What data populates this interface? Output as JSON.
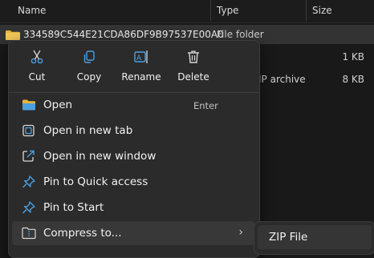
{
  "columns": {
    "name": "Name",
    "type": "Type",
    "size": "Size"
  },
  "rows": [
    {
      "name": "334589C544E21CDA86DF9B97537E00A0",
      "type": "File folder",
      "size": ""
    },
    {
      "name": "",
      "type": "",
      "size": "1 KB"
    },
    {
      "name": "",
      "type": "ZIP archive",
      "size": "8 KB"
    }
  ],
  "partial_type_text": "IP archive",
  "quick_actions": [
    {
      "label": "Cut",
      "icon": "scissors-icon"
    },
    {
      "label": "Copy",
      "icon": "copy-icon"
    },
    {
      "label": "Rename",
      "icon": "rename-icon"
    },
    {
      "label": "Delete",
      "icon": "trash-icon"
    }
  ],
  "menu_items": [
    {
      "label": "Open",
      "accelerator": "Enter",
      "icon": "folder-open-icon"
    },
    {
      "label": "Open in new tab",
      "icon": "new-tab-icon"
    },
    {
      "label": "Open in new window",
      "icon": "new-window-icon"
    },
    {
      "label": "Pin to Quick access",
      "icon": "pin-icon"
    },
    {
      "label": "Pin to Start",
      "icon": "pin-icon"
    },
    {
      "label": "Compress to...",
      "icon": "compress-icon",
      "has_submenu": true
    }
  ],
  "submenu": {
    "items": [
      {
        "label": "ZIP File"
      }
    ]
  },
  "colors": {
    "folder": "#E8B43C",
    "accent_blue": "#4CA0E0",
    "background": "#191919",
    "menu": "#2B2B2B"
  }
}
